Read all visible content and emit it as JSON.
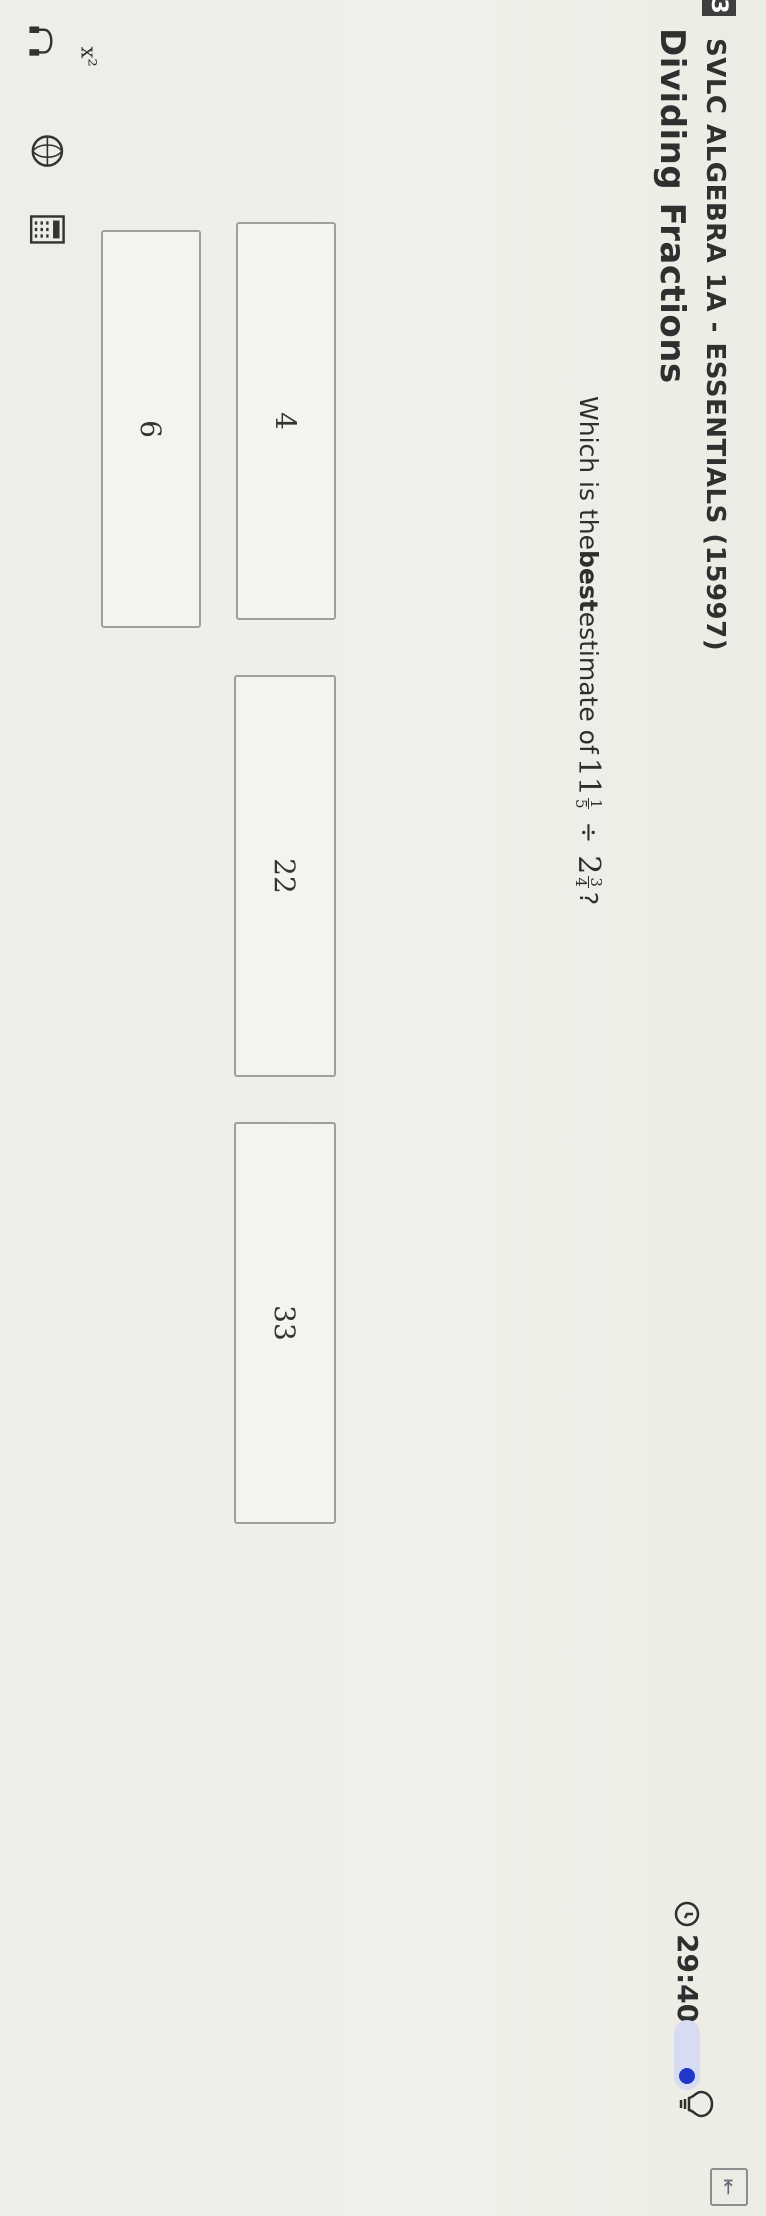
{
  "header": {
    "course_chip": "3",
    "course_title": "SVLC ALGEBRA 1A - ESSENTIALS (15997)",
    "lesson_title": "Dividing Fractions",
    "timer": "29:40"
  },
  "question": {
    "prefix": "Which is the ",
    "emphasis": "best",
    "middle": " estimate of ",
    "first_whole": "11",
    "first_num": "1",
    "first_den": "5",
    "operator": "÷",
    "second_whole": "2",
    "second_num": "3",
    "second_den": "4",
    "suffix": "?"
  },
  "choices": [
    {
      "label": "4"
    },
    {
      "label": "22"
    },
    {
      "label": "33"
    },
    {
      "label": "6"
    }
  ],
  "toolbar": {
    "tools": [
      "headphones-icon",
      "translate-globe-icon",
      "calculator-icon",
      "formula-icon"
    ]
  },
  "colors": {
    "background": "#ecede6",
    "toggle_track": "#d8dcf3",
    "toggle_knob": "#1f38c8",
    "choice_border": "#9ea0a0"
  }
}
